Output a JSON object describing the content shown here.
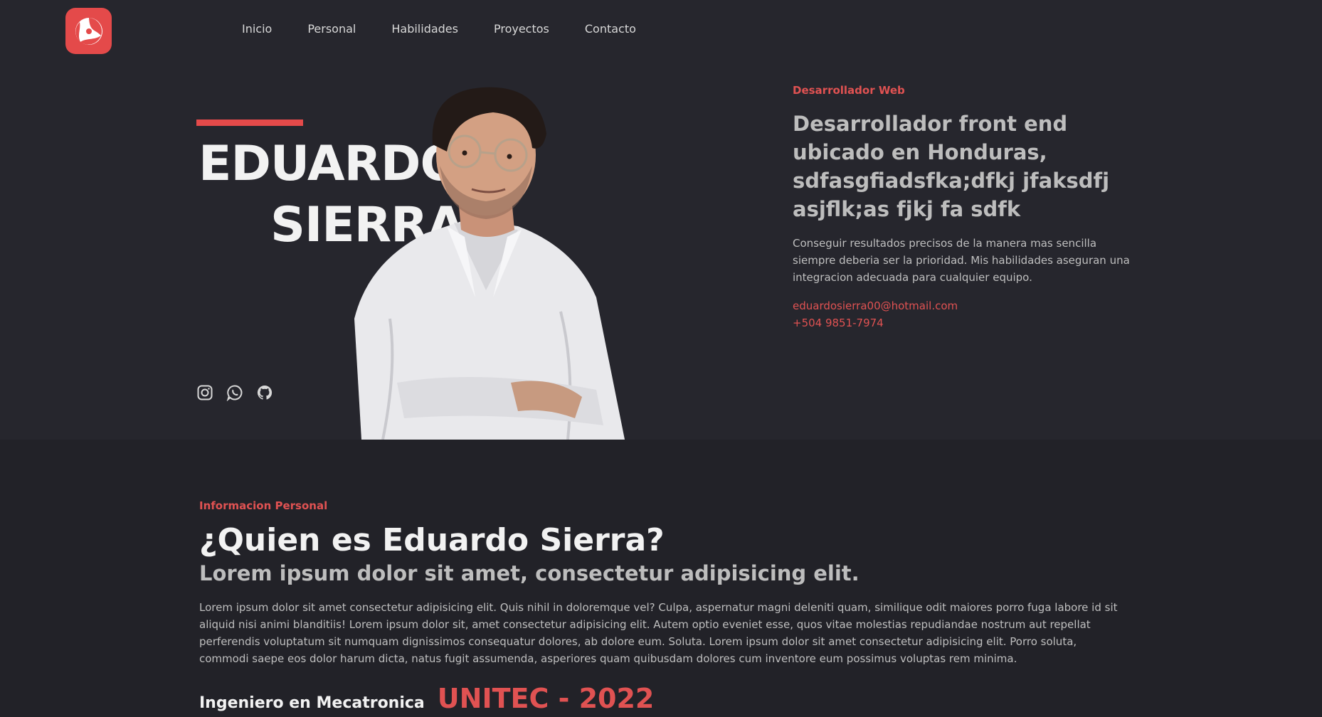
{
  "nav": {
    "logo_icon": "yin-yang-swirl-icon",
    "links": [
      "Inicio",
      "Personal",
      "Habilidades",
      "Proyectos",
      "Contacto"
    ]
  },
  "hero": {
    "name_line1": "EDUARDO",
    "name_line2": "SIERRA",
    "eyebrow": "Desarrollador Web",
    "headline": "Desarrollador front end ubicado en Honduras, sdfasgfiadsfka;dfkj jfaksdfj asjflk;as fjkj fa sdfk",
    "description": "Conseguir resultados precisos de la manera mas sencilla siempre deberia ser la prioridad. Mis habilidades aseguran una integracion adecuada para cualquier equipo.",
    "email": "eduardosierra00@hotmail.com",
    "phone": "+504 9851-7974",
    "socials": [
      "instagram-icon",
      "whatsapp-icon",
      "github-icon"
    ]
  },
  "personal": {
    "eyebrow": "Informacion Personal",
    "title": "¿Quien es Eduardo Sierra?",
    "subtitle": "Lorem ipsum dolor sit amet, consectetur adipisicing elit.",
    "body": "Lorem ipsum dolor sit amet consectetur adipisicing elit. Quis nihil in doloremque vel? Culpa, aspernatur magni deleniti quam, similique odit maiores porro fuga labore id sit aliquid nisi animi blanditiis! Lorem ipsum dolor sit, amet consectetur adipisicing elit. Autem optio eveniet esse, quos vitae molestias repudiandae nostrum aut repellat perferendis voluptatum sit numquam dignissimos consequatur dolores, ab dolore eum. Soluta. Lorem ipsum dolor sit amet consectetur adipisicing elit. Porro soluta, commodi saepe eos dolor harum dicta, natus fugit assumenda, asperiores quam quibusdam dolores cum inventore eum possimus voluptas rem minima.",
    "degree_label": "Ingeniero en Mecatronica",
    "degree_school": "UNITEC - 2022"
  },
  "colors": {
    "accent": "#e44a4a",
    "background": "#26262d",
    "section_background": "#222228"
  }
}
